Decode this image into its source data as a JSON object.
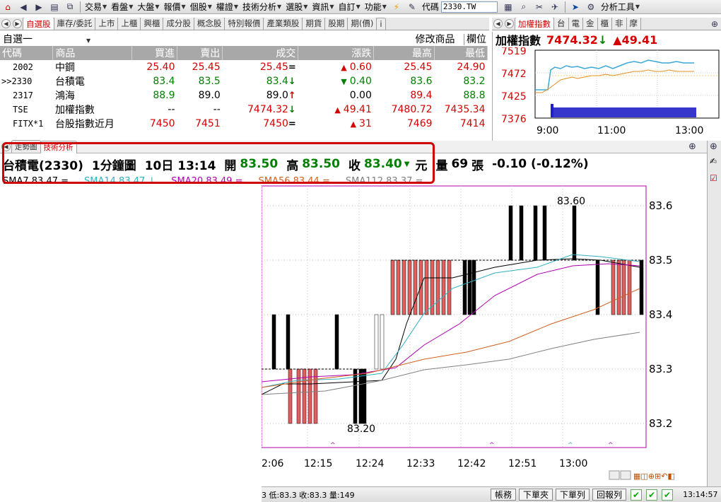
{
  "toolbar": {
    "menus": [
      {
        "label": "交易",
        "dropdown": true
      },
      {
        "label": "看盤",
        "dropdown": true
      },
      {
        "label": "大盤",
        "dropdown": true
      },
      {
        "label": "報價",
        "dropdown": true
      },
      {
        "label": "個股",
        "dropdown": true
      },
      {
        "label": "權證",
        "dropdown": true
      },
      {
        "label": "技術分析",
        "dropdown": true
      },
      {
        "label": "選股",
        "dropdown": true
      },
      {
        "label": "資訊",
        "dropdown": true
      },
      {
        "label": "自訂",
        "dropdown": true
      },
      {
        "label": "功能",
        "dropdown": true
      }
    ],
    "code_label": "代碼",
    "code_value": "2330.TW",
    "analysis_tools": "分析工具"
  },
  "watch_tabs": [
    "自選股",
    "庫存/委託",
    "上市",
    "上櫃",
    "興櫃",
    "成分股",
    "概念股",
    "特別報價",
    "產業類股",
    "期貨",
    "股期",
    "期(價)",
    "i"
  ],
  "watch_active": 0,
  "watch_head": {
    "group": "自選一",
    "edit": "修改商品",
    "cols_btn": "欄位"
  },
  "watch_columns": [
    "代碼",
    "商品",
    "買進",
    "賣出",
    "成交",
    "漲跌",
    "最高",
    "最低"
  ],
  "watch_rows": [
    {
      "code": "2002",
      "name": "中鋼",
      "bid": "25.40",
      "ask": "25.45",
      "last": "25.45",
      "last_mark": "=",
      "chg": "0.60",
      "chg_dir": "up",
      "high": "25.45",
      "low": "24.90",
      "color": "red"
    },
    {
      "code": ">>2330",
      "name": "台積電",
      "bid": "83.4",
      "ask": "83.5",
      "last": "83.4",
      "last_mark": "↓",
      "chg": "0.40",
      "chg_dir": "down",
      "high": "83.6",
      "low": "83.2",
      "color": "green"
    },
    {
      "code": "2317",
      "name": "鴻海",
      "bid": "88.9",
      "ask": "89.0",
      "last": "89.0",
      "last_mark": "↑",
      "chg": "0.00",
      "chg_dir": "none",
      "high": "89.4",
      "low": "88.8",
      "color": "mixed"
    },
    {
      "code": "TSE",
      "name": "加權指數",
      "bid": "--",
      "ask": "--",
      "last": "7474.32",
      "last_mark": "↓",
      "chg": "49.41",
      "chg_dir": "up",
      "high": "7480.72",
      "low": "7435.34",
      "color": "red"
    },
    {
      "code": "FITX*1",
      "name": "台股指數近月",
      "bid": "7450",
      "ask": "7451",
      "last": "7450",
      "last_mark": "=",
      "chg": "31",
      "chg_dir": "up",
      "high": "7469",
      "low": "7414",
      "color": "red"
    }
  ],
  "index_tabs": [
    "加權指數",
    "台",
    "電",
    "金",
    "櫃",
    "非",
    "摩"
  ],
  "index_head": {
    "name": "加權指數",
    "value": "7474.32",
    "arrow": "↓",
    "change": "▲49.41"
  },
  "index_chart": {
    "y_ticks": [
      "7519",
      "7472",
      "7425",
      "7376"
    ],
    "x_ticks": [
      "9:00",
      "11:00",
      "13:00"
    ]
  },
  "chart_tabs": [
    "走勢圖",
    "技術分析"
  ],
  "chart_active": 1,
  "quote": {
    "name": "台積電(2330)",
    "period": "1分鐘圖",
    "datetime": "10日 13:14",
    "open_label": "開",
    "open": "83.50",
    "high_label": "高",
    "high": "83.50",
    "close_label": "收",
    "close": "83.40",
    "unit": "元",
    "vol_label": "量",
    "volume": "69",
    "vol_unit": "張",
    "change": "-0.10 (-0.12%)"
  },
  "sma": [
    {
      "text": "SMA7 83.47 =",
      "color": "#000000"
    },
    {
      "text": "SMA14 83.47 ↓",
      "color": "#30b0c0"
    },
    {
      "text": "SMA20 83.49 =",
      "color": "#b000b0"
    },
    {
      "text": "SMA56 83.44 =",
      "color": "#d06020"
    },
    {
      "text": "SMA112 83.37 =",
      "color": "#808080"
    }
  ],
  "main_chart": {
    "y_ticks": [
      "83.6",
      "83.5",
      "83.4",
      "83.3",
      "83.2"
    ],
    "x_ticks": [
      "2:06",
      "12:15",
      "12:24",
      "12:33",
      "12:42",
      "12:51",
      "13:00"
    ],
    "max_label": "83.60",
    "min_label": "83.20"
  },
  "status": {
    "info": "3 低:83.3 收:83.3 量:149",
    "btn_account": "帳務",
    "btn_order_clip": "下單夾",
    "btn_order_list": "下單列",
    "btn_report": "回報列",
    "time": "13:14:57"
  },
  "colors": {
    "up": "#d40000",
    "down": "#008000",
    "highlight": "#d00000",
    "header_gray": "#a8a8a8"
  }
}
